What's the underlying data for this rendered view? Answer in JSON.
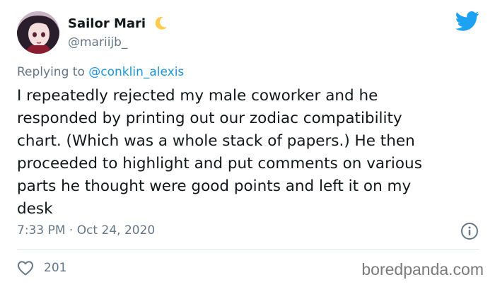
{
  "author": {
    "display_name": "Sailor Mari",
    "handle": "@mariijb_",
    "emoji_icon": "crescent-moon-icon"
  },
  "reply": {
    "prefix": "Replying to ",
    "mention": "@conklin_alexis"
  },
  "tweet": {
    "text": "I repeatedly rejected my male coworker and he\nresponded by printing out our zodiac compatibility\nchart. (Which was a whole stack of papers.) He then\nproceeded to highlight and put comments on various\nparts he thought were good points and left it on my\ndesk",
    "timestamp": "7:33 PM · Oct 24, 2020",
    "likes": "201"
  },
  "watermark": "boredpanda.com",
  "icons": {
    "brand": "twitter-bird-icon",
    "info": "info-icon",
    "like": "heart-icon"
  },
  "colors": {
    "brand_blue": "#1da1f2",
    "link_blue": "#1b95e0",
    "secondary_text": "#657786",
    "primary_text": "#14171a",
    "moon_yellow": "#ffcc4d"
  }
}
